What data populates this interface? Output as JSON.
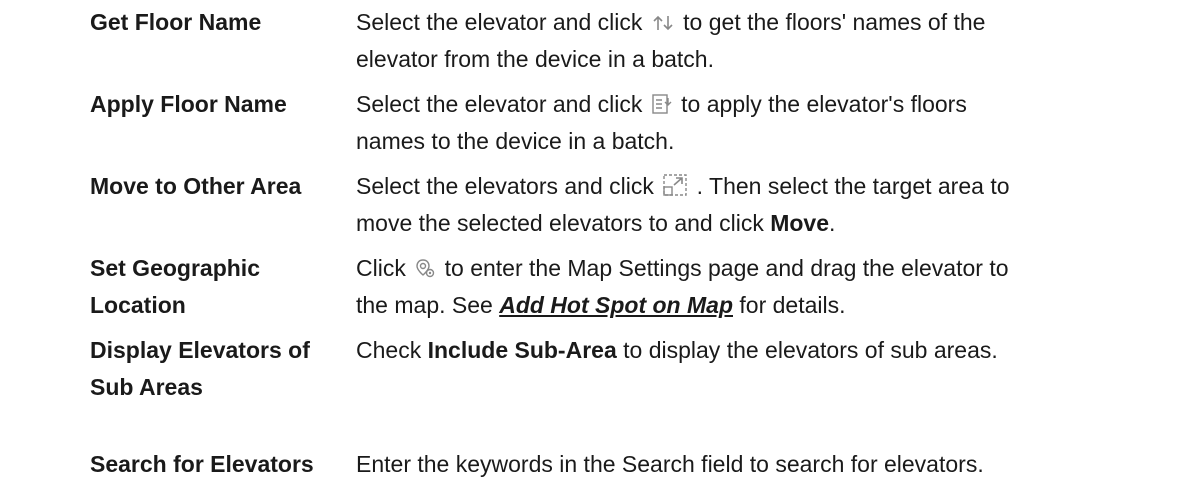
{
  "rows": [
    {
      "term": "Get Floor Name",
      "desc_a": "Select the elevator and click",
      "icon": "get-floor-name-icon",
      "desc_b": "to get the floors' names of the",
      "desc_c": "elevator from the device in a batch."
    },
    {
      "term": "Apply Floor Name",
      "desc_a": "Select the elevator and click",
      "icon": "apply-floor-name-icon",
      "desc_b": "to apply the elevator's floors",
      "desc_c": "names to the device in a batch."
    },
    {
      "term": "Move to Other Area",
      "desc_a": "Select the elevators and click",
      "icon": "move-to-area-icon",
      "desc_b": ". Then select the target area to",
      "desc_c": "move the selected elevators to and click",
      "desc_bold": "Move",
      "desc_end": "."
    },
    {
      "term_1": "Set Geographic",
      "term_2": "Location",
      "desc_a": "Click",
      "icon": "location-pin-icon",
      "desc_b": "to enter the Map Settings page and drag the elevator to",
      "desc_c": "the map. See",
      "link": "Add Hot Spot on Map",
      "desc_d": "for details."
    },
    {
      "term_1": "Display Elevators of",
      "term_2": "Sub Areas",
      "desc_a": "Check",
      "desc_bold": "Include Sub-Area",
      "desc_b": "to display the elevators of sub areas."
    },
    {
      "term": "Search for Elevators",
      "desc_a": "Enter the keywords in the Search field to search for elevators."
    }
  ]
}
